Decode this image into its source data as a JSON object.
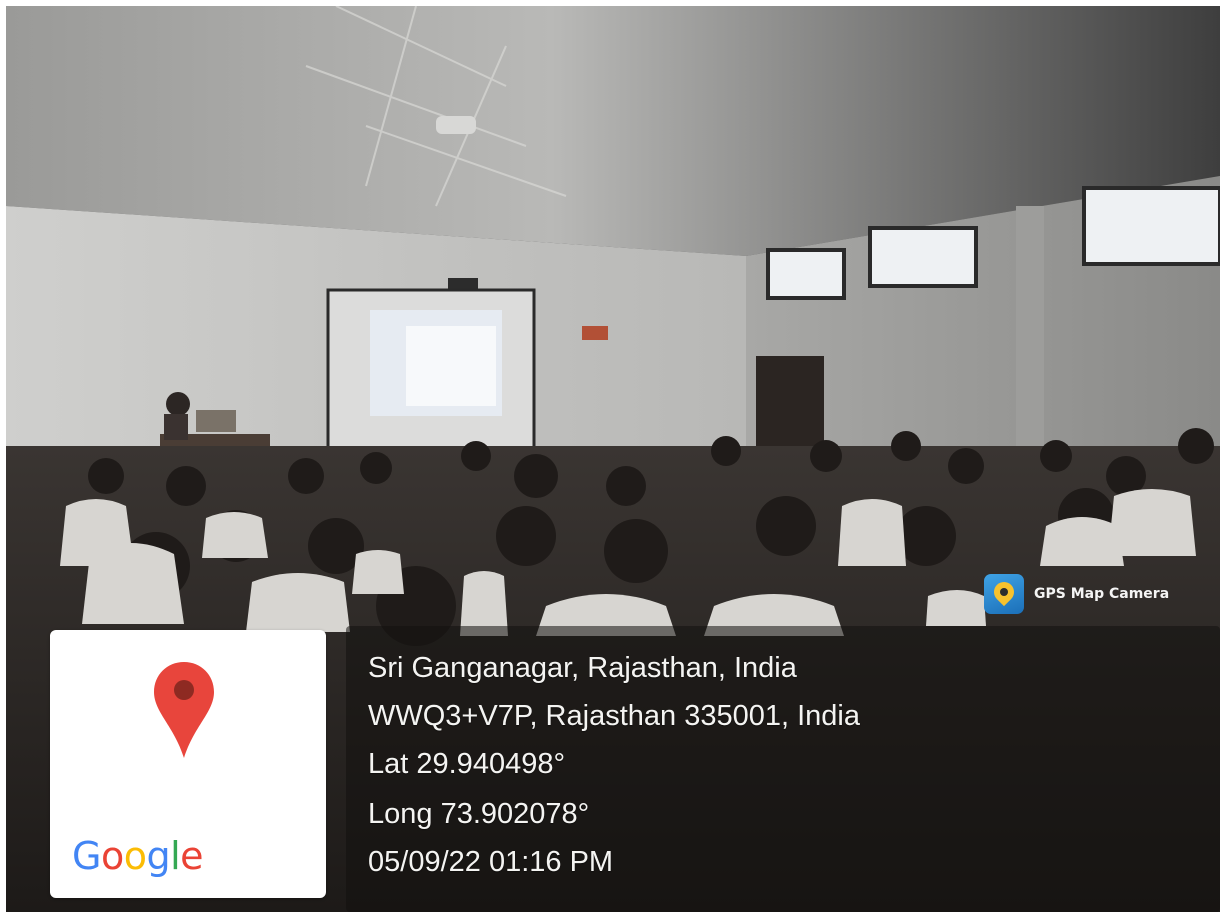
{
  "overlay": {
    "app_name": "GPS Map Camera",
    "address_line_1": "Sri Ganganagar, Rajasthan, India",
    "address_line_2": "WWQ3+V7P, Rajasthan 335001, India",
    "latitude": "Lat 29.940498°",
    "longitude": "Long 73.902078°",
    "datetime": "05/09/22 01:16 PM"
  },
  "map_thumbnail": {
    "logo_text": "Google",
    "logo_letters": [
      {
        "char": "G",
        "color": "#4285F4"
      },
      {
        "char": "o",
        "color": "#EA4335"
      },
      {
        "char": "o",
        "color": "#FBBC05"
      },
      {
        "char": "g",
        "color": "#4285F4"
      },
      {
        "char": "l",
        "color": "#34A853"
      },
      {
        "char": "e",
        "color": "#EA4335"
      }
    ],
    "pin_icon": "map-pin-icon",
    "pin_color": "#E8453C"
  },
  "colors": {
    "panel_background": "rgba(18,16,14,0.55)",
    "overlay_text": "#f4f4f2"
  }
}
